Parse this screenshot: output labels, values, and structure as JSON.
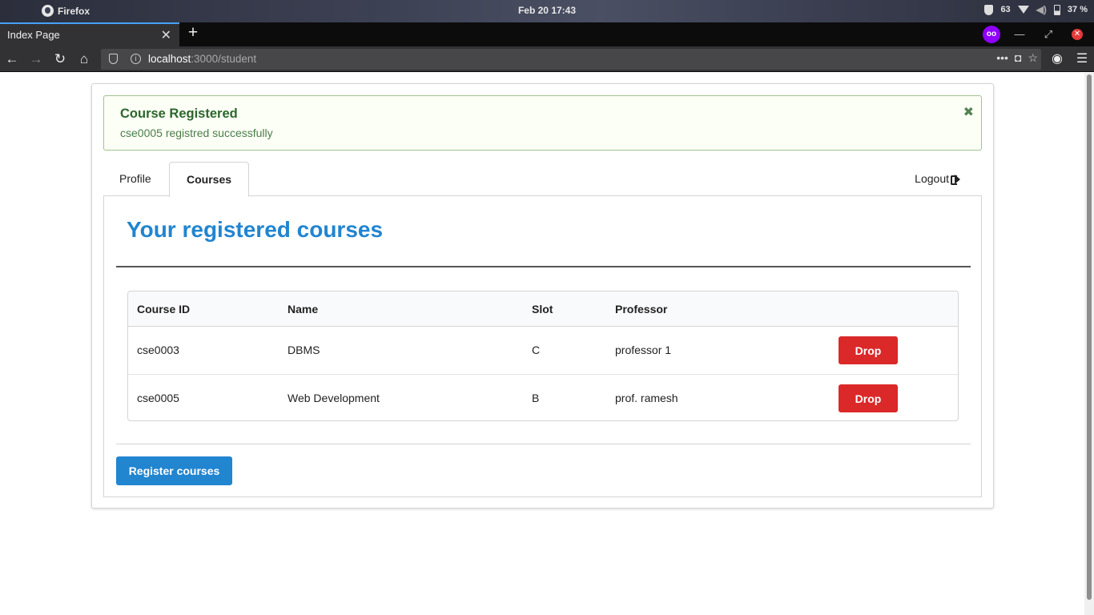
{
  "os": {
    "app_name": "Firefox",
    "clock": "Feb 20  17:43",
    "tray_count": "63",
    "battery": "37 %"
  },
  "browser": {
    "tab_title": "Index Page",
    "new_tab_symbol": "+",
    "tab_close_symbol": "✕",
    "url_host": "localhost",
    "url_path": ":3000/student",
    "private_mask_icon": "mask-icon",
    "accent_color": "#45a1ff"
  },
  "alert": {
    "title": "Course Registered",
    "message": "cse0005 registred successfully",
    "close_symbol": "✖",
    "color": "#2c662d"
  },
  "tabs": {
    "profile": "Profile",
    "courses": "Courses",
    "active": "Courses",
    "logout": "Logout"
  },
  "main": {
    "heading": "Your registered courses",
    "heading_color": "#2185d0",
    "register_button": "Register courses"
  },
  "table": {
    "headers": [
      "Course ID",
      "Name",
      "Slot",
      "Professor"
    ],
    "rows": [
      {
        "course_id": "cse0003",
        "name": "DBMS",
        "slot": "C",
        "professor": "professor 1",
        "action": "Drop"
      },
      {
        "course_id": "cse0005",
        "name": "Web Development",
        "slot": "B",
        "professor": "prof. ramesh",
        "action": "Drop"
      }
    ],
    "drop_color": "#db2828"
  }
}
